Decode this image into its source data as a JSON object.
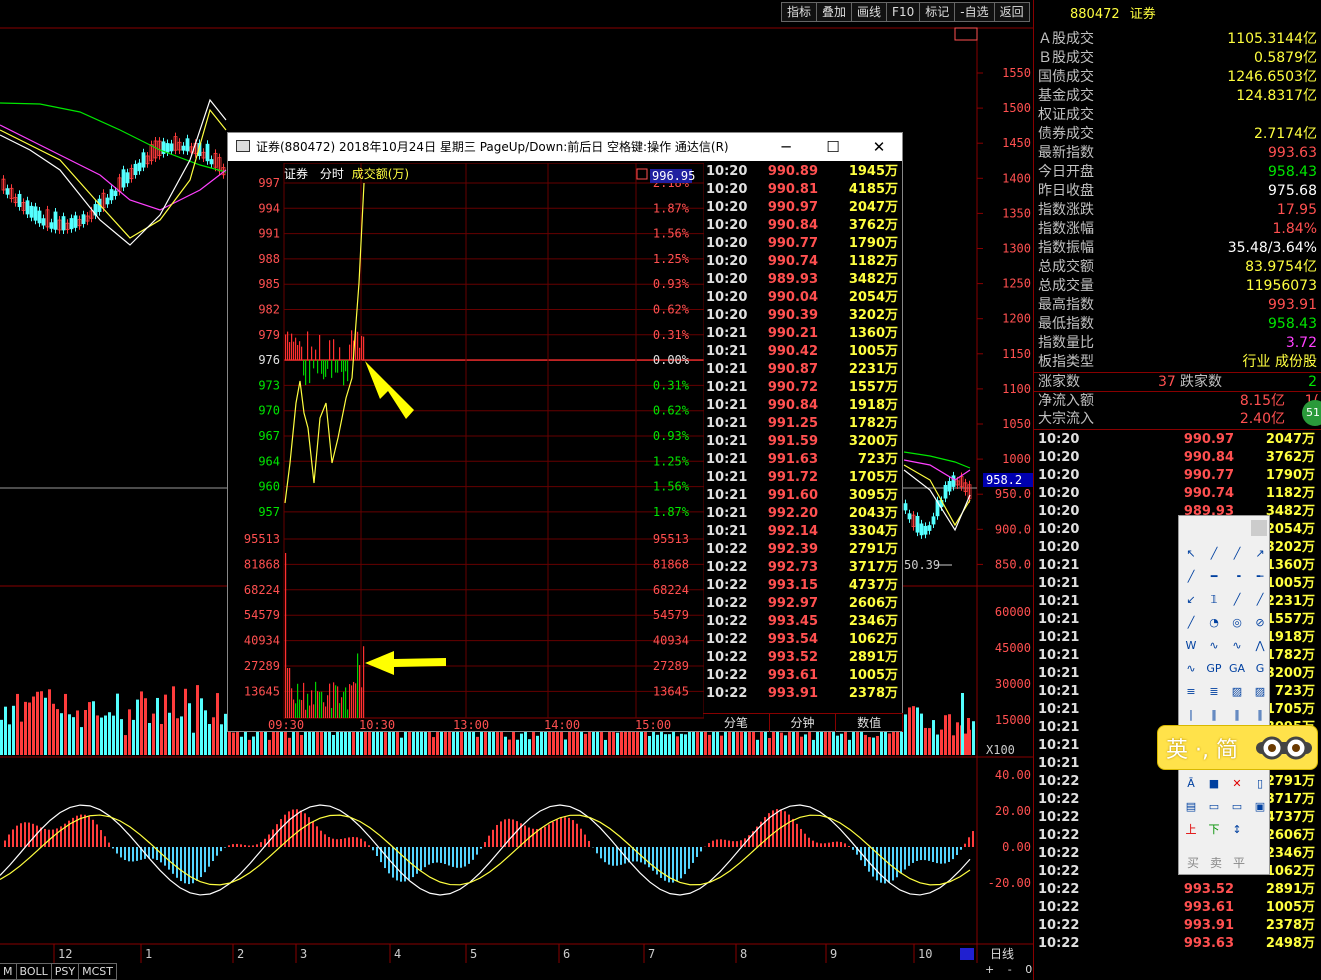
{
  "toolbar": {
    "items": [
      "指标",
      "叠加",
      "画线",
      "F10",
      "标记",
      "-自选",
      "返回"
    ]
  },
  "main_chart": {
    "price_axis": [
      "1550",
      "1500",
      "1450",
      "1400",
      "1350",
      "1300",
      "1250",
      "1200",
      "1150",
      "1100",
      "1050",
      "1000",
      "950.0",
      "900.0",
      "850.0"
    ],
    "current_price_tag": "958.2",
    "low_marker": "50.39",
    "volume_axis": [
      "60000",
      "45000",
      "30000",
      "15000"
    ],
    "volume_unit": "X100",
    "macd_axis": [
      "40.00",
      "20.00",
      "0.00",
      "-20.00"
    ],
    "date_labels": [
      "12",
      "1",
      "2",
      "3",
      "4",
      "5",
      "6",
      "7",
      "8",
      "9",
      "10"
    ],
    "period": "日线",
    "indicator_tabs": [
      "M",
      "BOLL",
      "PSY",
      "MCST"
    ],
    "scroll_controls": [
      "+",
      "-",
      "0"
    ],
    "colors": {
      "up": "#ff3c3c",
      "down": "#54ffff",
      "ma_white": "#ffffff",
      "ma_yellow": "#ffff40",
      "ma_pink": "#ff40ff",
      "ma_green": "#00e600"
    }
  },
  "right_panel": {
    "code": "880472",
    "name": "证券",
    "rows": [
      {
        "label": "Ａ股成交",
        "value": "1105.3144亿",
        "color": "yellow"
      },
      {
        "label": "Ｂ股成交",
        "value": "0.5879亿",
        "color": "yellow"
      },
      {
        "label": "国债成交",
        "value": "1246.6503亿",
        "color": "yellow"
      },
      {
        "label": "基金成交",
        "value": "124.8317亿",
        "color": "yellow"
      },
      {
        "label": "权证成交",
        "value": "",
        "color": "yellow"
      },
      {
        "label": "债券成交",
        "value": "2.7174亿",
        "color": "yellow"
      },
      {
        "label": "最新指数",
        "value": "993.63",
        "color": "red"
      },
      {
        "label": "今日开盘",
        "value": "958.43",
        "color": "green"
      },
      {
        "label": "昨日收盘",
        "value": "975.68",
        "color": "white"
      },
      {
        "label": "指数涨跌",
        "value": "17.95",
        "color": "red"
      },
      {
        "label": "指数涨幅",
        "value": "1.84%",
        "color": "red"
      },
      {
        "label": "指数振幅",
        "value": "35.48/3.64%",
        "color": "white"
      },
      {
        "label": "总成交额",
        "value": "83.9754亿",
        "color": "yellow"
      },
      {
        "label": "总成交量",
        "value": "11956073",
        "color": "yellow"
      },
      {
        "label": "最高指数",
        "value": "993.91",
        "color": "red"
      },
      {
        "label": "最低指数",
        "value": "958.43",
        "color": "green"
      },
      {
        "label": "指数量比",
        "value": "3.72",
        "color": "purple"
      },
      {
        "label": "板指类型",
        "value": "行业 成份股",
        "color": "yellow"
      }
    ],
    "rise_label": "涨家数",
    "rise_value": "37",
    "fall_label": "跌家数",
    "fall_value": "2",
    "inflow_label": "净流入额",
    "inflow_value": "8.15亿",
    "inflow_extra": "1(",
    "block_label": "大宗流入",
    "block_value": "2.40亿",
    "block_extra": "3.",
    "badge": "51",
    "ticks": [
      {
        "time": "10:20",
        "price": "990.97",
        "vol": "2047万"
      },
      {
        "time": "10:20",
        "price": "990.84",
        "vol": "3762万"
      },
      {
        "time": "10:20",
        "price": "990.77",
        "vol": "1790万"
      },
      {
        "time": "10:20",
        "price": "990.74",
        "vol": "1182万"
      },
      {
        "time": "10:20",
        "price": "989.93",
        "vol": "3482万"
      },
      {
        "time": "10:20",
        "price": "990.04",
        "vol": "2054万"
      },
      {
        "time": "10:20",
        "price": "990.39",
        "vol": "3202万"
      },
      {
        "time": "10:21",
        "price": "990.21",
        "vol": "1360万"
      },
      {
        "time": "10:21",
        "price": "990.42",
        "vol": "1005万"
      },
      {
        "time": "10:21",
        "price": "990.87",
        "vol": "2231万"
      },
      {
        "time": "10:21",
        "price": "990.72",
        "vol": "1557万"
      },
      {
        "time": "10:21",
        "price": "990.84",
        "vol": "1918万"
      },
      {
        "time": "10:21",
        "price": "991.25",
        "vol": "1782万"
      },
      {
        "time": "10:21",
        "price": "991.59",
        "vol": "3200万"
      },
      {
        "time": "10:21",
        "price": "991.63",
        "vol": "723万"
      },
      {
        "time": "10:21",
        "price": "991.72",
        "vol": "1705万"
      },
      {
        "time": "10:21",
        "price": "991.60",
        "vol": "3095万"
      },
      {
        "time": "10:21",
        "price": "992.20",
        "vol": "2043万"
      },
      {
        "time": "10:21",
        "price": "992.14",
        "vol": "3304万"
      },
      {
        "time": "10:22",
        "price": "992.39",
        "vol": "2791万"
      },
      {
        "time": "10:22",
        "price": "992.73",
        "vol": "3717万"
      },
      {
        "time": "10:22",
        "price": "993.15",
        "vol": "4737万"
      },
      {
        "time": "10:22",
        "price": "992.97",
        "vol": "2606万"
      },
      {
        "time": "10:22",
        "price": "993.45",
        "vol": "2346万"
      },
      {
        "time": "10:22",
        "price": "993.54",
        "vol": "1062万"
      },
      {
        "time": "10:22",
        "price": "993.52",
        "vol": "2891万"
      },
      {
        "time": "10:22",
        "price": "993.61",
        "vol": "1005万"
      },
      {
        "time": "10:22",
        "price": "993.91",
        "vol": "2378万"
      },
      {
        "time": "10:22",
        "price": "993.63",
        "vol": "2498万"
      }
    ]
  },
  "popup": {
    "title": "证券(880472) 2018年10月24日 星期三 PageUp/Down:前后日 空格键:操作 通达信(R)",
    "header_name": "证券",
    "header_mode": "分时",
    "header_field": "成交额(万)",
    "price_tag": "996.95",
    "price_axis": [
      "997",
      "994",
      "991",
      "988",
      "985",
      "982",
      "979",
      "976",
      "973",
      "970",
      "967",
      "964",
      "960",
      "957"
    ],
    "pct_axis": [
      "2.18%",
      "1.87%",
      "1.56%",
      "1.25%",
      "0.93%",
      "0.62%",
      "0.31%",
      "0.00%",
      "0.31%",
      "0.62%",
      "0.93%",
      "1.25%",
      "1.56%",
      "1.87%"
    ],
    "vol_axis": [
      "95513",
      "81868",
      "68224",
      "54579",
      "40934",
      "27289",
      "13645"
    ],
    "time_axis": [
      "09:30",
      "10:30",
      "13:00",
      "14:00",
      "15:00"
    ],
    "tabs": [
      "分笔",
      "分钟",
      "数值"
    ],
    "ticks": [
      {
        "time": "10:20",
        "price": "990.89",
        "vol": "1945万"
      },
      {
        "time": "10:20",
        "price": "990.81",
        "vol": "4185万"
      },
      {
        "time": "10:20",
        "price": "990.97",
        "vol": "2047万"
      },
      {
        "time": "10:20",
        "price": "990.84",
        "vol": "3762万"
      },
      {
        "time": "10:20",
        "price": "990.77",
        "vol": "1790万"
      },
      {
        "time": "10:20",
        "price": "990.74",
        "vol": "1182万"
      },
      {
        "time": "10:20",
        "price": "989.93",
        "vol": "3482万"
      },
      {
        "time": "10:20",
        "price": "990.04",
        "vol": "2054万"
      },
      {
        "time": "10:20",
        "price": "990.39",
        "vol": "3202万"
      },
      {
        "time": "10:21",
        "price": "990.21",
        "vol": "1360万"
      },
      {
        "time": "10:21",
        "price": "990.42",
        "vol": "1005万"
      },
      {
        "time": "10:21",
        "price": "990.87",
        "vol": "2231万"
      },
      {
        "time": "10:21",
        "price": "990.72",
        "vol": "1557万"
      },
      {
        "time": "10:21",
        "price": "990.84",
        "vol": "1918万"
      },
      {
        "time": "10:21",
        "price": "991.25",
        "vol": "1782万"
      },
      {
        "time": "10:21",
        "price": "991.59",
        "vol": "3200万"
      },
      {
        "time": "10:21",
        "price": "991.63",
        "vol": "723万"
      },
      {
        "time": "10:21",
        "price": "991.72",
        "vol": "1705万"
      },
      {
        "time": "10:21",
        "price": "991.60",
        "vol": "3095万"
      },
      {
        "time": "10:21",
        "price": "992.20",
        "vol": "2043万"
      },
      {
        "time": "10:21",
        "price": "992.14",
        "vol": "3304万"
      },
      {
        "time": "10:22",
        "price": "992.39",
        "vol": "2791万"
      },
      {
        "time": "10:22",
        "price": "992.73",
        "vol": "3717万"
      },
      {
        "time": "10:22",
        "price": "993.15",
        "vol": "4737万"
      },
      {
        "time": "10:22",
        "price": "992.97",
        "vol": "2606万"
      },
      {
        "time": "10:22",
        "price": "993.45",
        "vol": "2346万"
      },
      {
        "time": "10:22",
        "price": "993.54",
        "vol": "1062万"
      },
      {
        "time": "10:22",
        "price": "993.52",
        "vol": "2891万"
      },
      {
        "time": "10:22",
        "price": "993.61",
        "vol": "1005万"
      },
      {
        "time": "10:22",
        "price": "993.91",
        "vol": "2378万"
      }
    ]
  },
  "ime": {
    "text": "英 ·, 简"
  },
  "drawing_tools": {
    "bottom_labels": [
      "买",
      "卖",
      "平"
    ],
    "icons": [
      "cursor-icon",
      "line-segment-icon",
      "ray-icon",
      "extended-line-icon",
      "channel-icon",
      "parallel-line-icon",
      "text-icon",
      "arrow-up-icon",
      "arrow-down-icon",
      "delete-icon"
    ]
  }
}
